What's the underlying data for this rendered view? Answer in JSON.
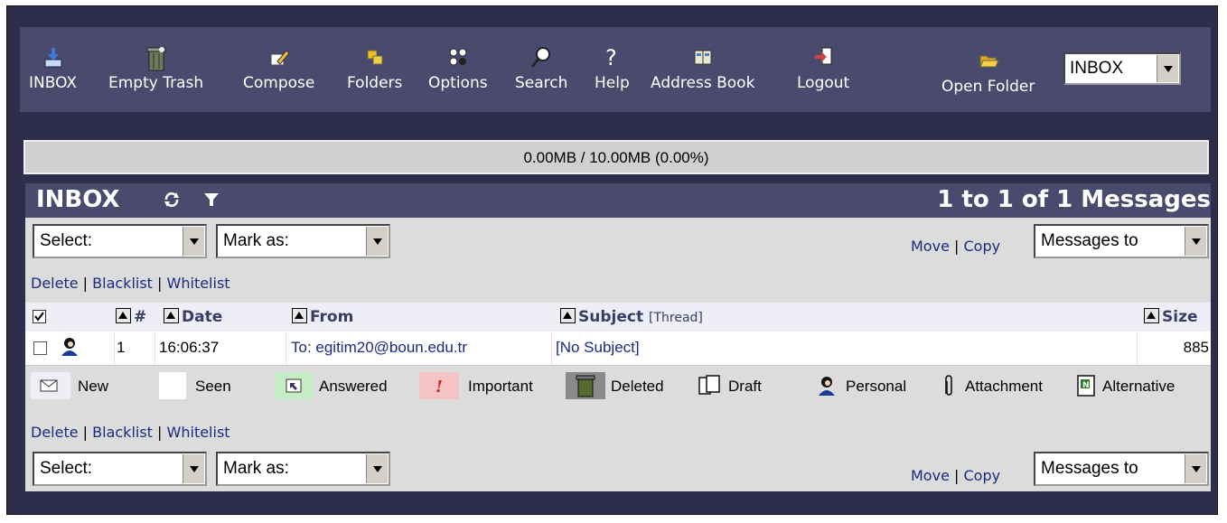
{
  "toolbar": {
    "items": [
      {
        "label": "INBOX",
        "icon": "inbox-download-icon"
      },
      {
        "label": "Empty Trash",
        "icon": "trash-can-icon"
      },
      {
        "label": "Compose",
        "icon": "compose-pencil-icon"
      },
      {
        "label": "Folders",
        "icon": "folders-icon"
      },
      {
        "label": "Options",
        "icon": "options-icon"
      },
      {
        "label": "Search",
        "icon": "magnifier-icon"
      },
      {
        "label": "Help",
        "icon": "question-mark-icon"
      },
      {
        "label": "Address Book",
        "icon": "address-book-icon"
      },
      {
        "label": "Logout",
        "icon": "logout-door-icon"
      }
    ],
    "open_folder_label": "Open Folder",
    "folder_select_value": "INBOX"
  },
  "quota": "0.00MB / 10.00MB (0.00%)",
  "mailbox": {
    "title": "INBOX",
    "count_text": "1 to 1 of 1 Messages"
  },
  "controls": {
    "select_label": "Select:",
    "mark_as_label": "Mark as:",
    "move_label": "Move",
    "copy_label": "Copy",
    "separator": "|",
    "messages_to_label": "Messages to",
    "delete_label": "Delete",
    "blacklist_label": "Blacklist",
    "whitelist_label": "Whitelist"
  },
  "table": {
    "columns": {
      "num": "#",
      "date": "Date",
      "from": "From",
      "subject": "Subject",
      "thread": "[Thread]",
      "size": "Size"
    },
    "rows": [
      {
        "num": "1",
        "date": "16:06:37",
        "from": "To: egitim20@boun.edu.tr",
        "subject": "[No Subject]",
        "size": "885"
      }
    ]
  },
  "legend": [
    {
      "label": "New",
      "icon": "envelope-icon"
    },
    {
      "label": "Seen",
      "icon": ""
    },
    {
      "label": "Answered",
      "icon": "reply-arrow-icon"
    },
    {
      "label": "Important",
      "icon": "exclamation-icon"
    },
    {
      "label": "Deleted",
      "icon": "trash-can-icon"
    },
    {
      "label": "Draft",
      "icon": "draft-pages-icon"
    },
    {
      "label": "Personal",
      "icon": "person-icon"
    },
    {
      "label": "Attachment",
      "icon": "paperclip-icon"
    },
    {
      "label": "Alternative",
      "icon": "alternative-document-icon"
    }
  ],
  "colors": {
    "frame_bg": "#2e2e4c",
    "header_bg": "#4a4a6e",
    "content_bg": "#dcdcdc",
    "link": "#1a2b80",
    "answered_bg": "#c6ecc6",
    "important_bg": "#f4c4c4",
    "deleted_bg": "#8a8a8a"
  }
}
